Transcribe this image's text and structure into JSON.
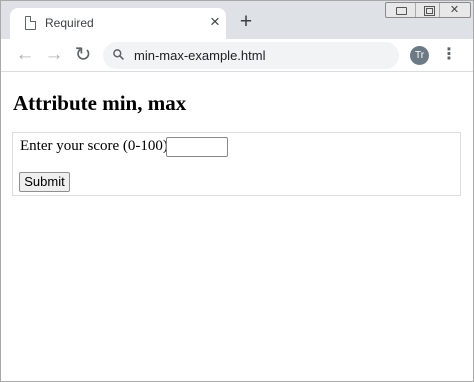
{
  "browser": {
    "tab_title": "Required",
    "tab_close": "×",
    "new_tab": "+",
    "window_close": "✕",
    "nav": {
      "back": "←",
      "forward": "→",
      "reload": "↻"
    },
    "url": "min-max-example.html",
    "profile_initials": "Tr",
    "menu": "⋮"
  },
  "page": {
    "heading": "Attribute min, max",
    "form": {
      "score_label": "Enter your score (0-100):",
      "score_value": "",
      "submit_label": "Submit"
    }
  }
}
